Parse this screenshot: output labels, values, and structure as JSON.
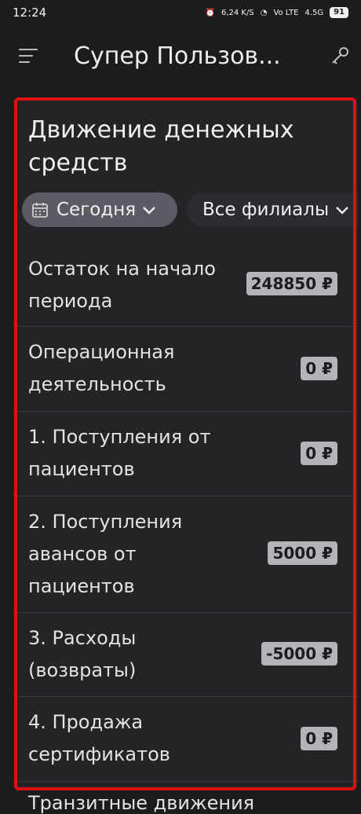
{
  "status_bar": {
    "time": "12:24",
    "network_speed": "6,24 K/S",
    "carrier1": "Vo LTE",
    "carrier2": "4.5G",
    "battery": "91"
  },
  "app_bar": {
    "title": "Супер Пользов..."
  },
  "card": {
    "title": "Движение денежных средств",
    "filters": {
      "period": "Сегодня",
      "branches": "Все филиалы"
    },
    "rows": [
      {
        "label": "Остаток на начало периода",
        "amount": "248850 ₽"
      },
      {
        "label": "Операционная деятельность",
        "amount": "0 ₽"
      },
      {
        "label": "1. Поступления от пациентов",
        "amount": "0 ₽"
      },
      {
        "label": "2. Поступления авансов от пациентов",
        "amount": "5000 ₽"
      },
      {
        "label": "3. Расходы (возвраты)",
        "amount": "-5000 ₽"
      },
      {
        "label": "4. Продажа сертификатов",
        "amount": "0 ₽"
      }
    ],
    "next_row_partial": "Транзитные движения"
  },
  "colors": {
    "background": "#1c1c1e",
    "card": "#242426",
    "highlight": "#e01010",
    "badge": "#b4b4b8"
  }
}
